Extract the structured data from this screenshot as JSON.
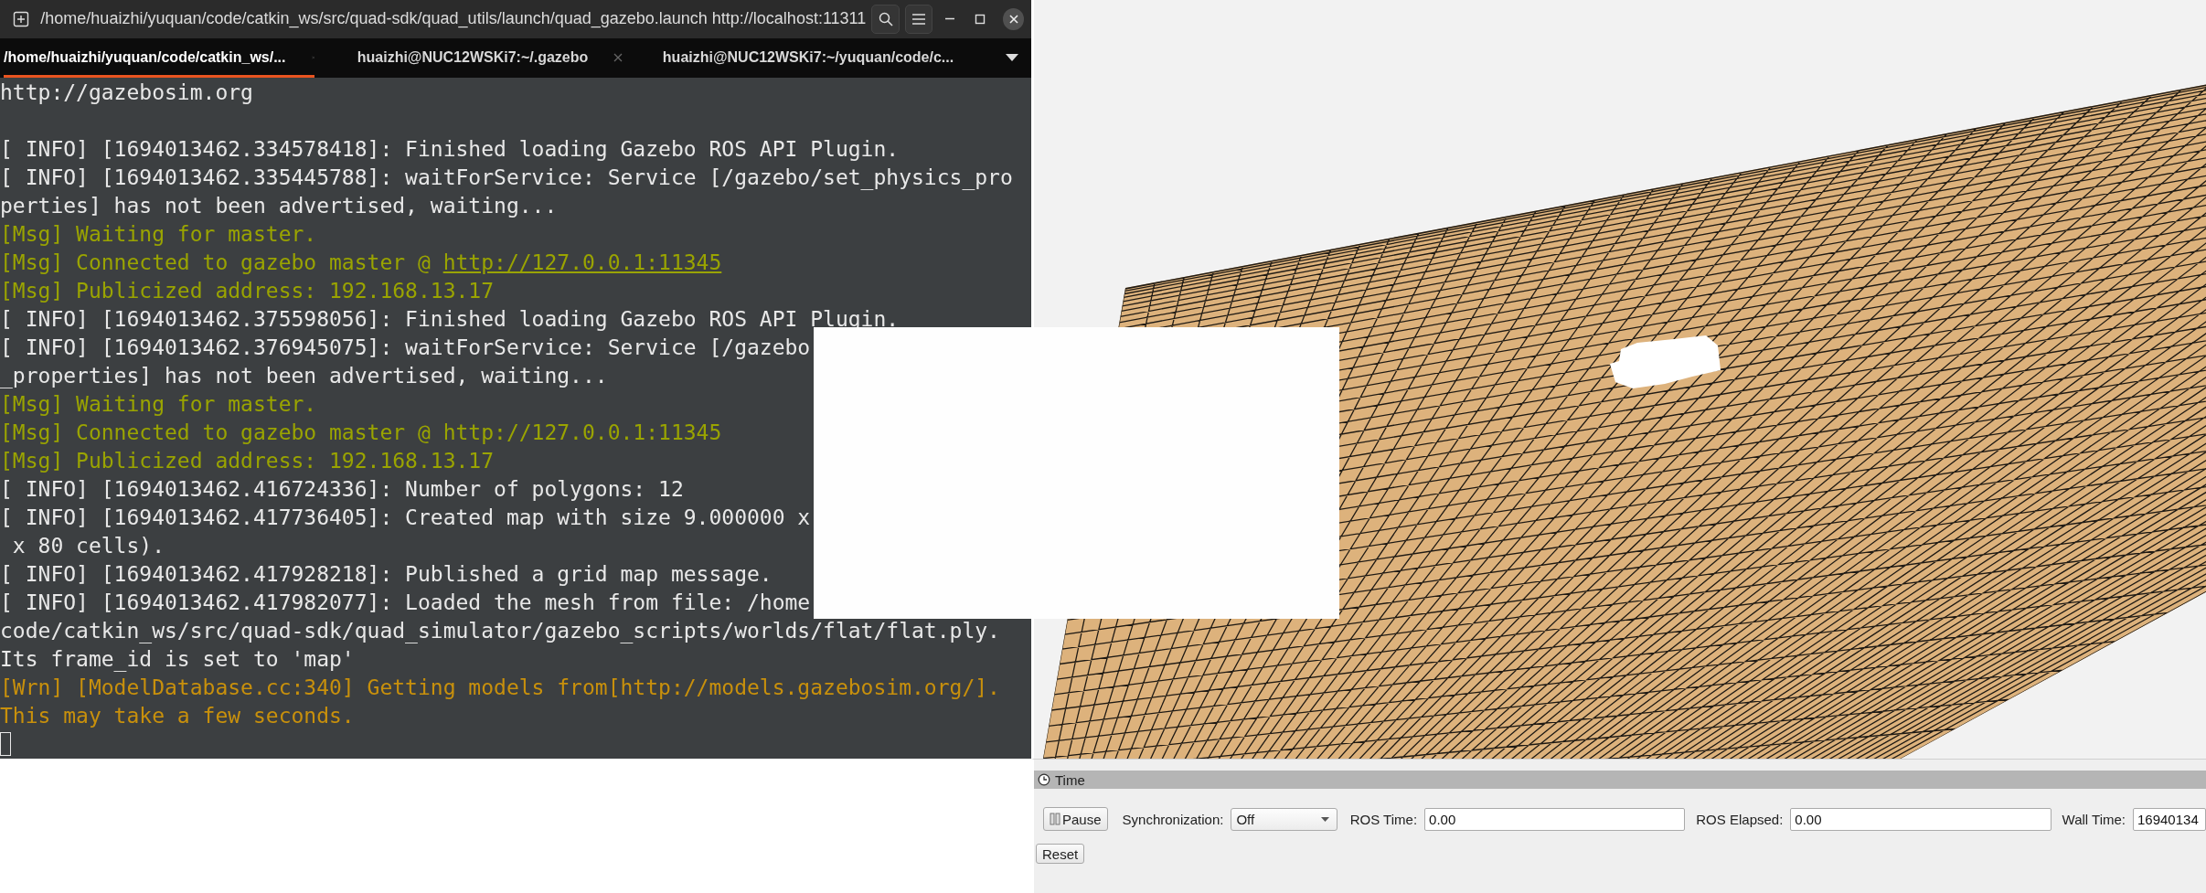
{
  "terminal": {
    "title": "/home/huaizhi/yuquan/code/catkin_ws/src/quad-sdk/quad_utils/launch/quad_gazebo.launch http://localhost:11311",
    "tabs": [
      {
        "label": "/home/huaizhi/yuquan/code/catkin_ws/...",
        "selected": true
      },
      {
        "label": "huaizhi@NUC12WSKi7:~/.gazebo",
        "selected": false
      },
      {
        "label": "huaizhi@NUC12WSKi7:~/yuquan/code/c...",
        "selected": false
      }
    ],
    "lines": [
      {
        "kind": "normal",
        "text": "http://gazebosim.org"
      },
      {
        "kind": "blank"
      },
      {
        "kind": "normal",
        "text": "[ INFO] [1694013462.334578418]: Finished loading Gazebo ROS API Plugin."
      },
      {
        "kind": "normal",
        "text": "[ INFO] [1694013462.335445788]: waitForService: Service [/gazebo/set_physics_pro"
      },
      {
        "kind": "normal",
        "text": "perties] has not been advertised, waiting..."
      },
      {
        "kind": "msg",
        "text": "[Msg] Waiting for master."
      },
      {
        "kind": "msg",
        "text": "[Msg] Connected to gazebo master @ ",
        "link": "http://127.0.0.1:11345"
      },
      {
        "kind": "msg",
        "text": "[Msg] Publicized address: 192.168.13.17"
      },
      {
        "kind": "normal",
        "text": "[ INFO] [1694013462.375598056]: Finished loading Gazebo ROS API Plugin."
      },
      {
        "kind": "normal",
        "text": "[ INFO] [1694013462.376945075]: waitForService: Service [/gazebo"
      },
      {
        "kind": "normal",
        "text": "_properties] has not been advertised, waiting..."
      },
      {
        "kind": "msg",
        "text": "[Msg] Waiting for master."
      },
      {
        "kind": "msg",
        "text": "[Msg] Connected to gazebo master @ http://127.0.0.1:11345"
      },
      {
        "kind": "msg",
        "text": "[Msg] Publicized address: 192.168.13.17"
      },
      {
        "kind": "normal",
        "text": "[ INFO] [1694013462.416724336]: Number of polygons: 12"
      },
      {
        "kind": "normal",
        "text": "[ INFO] [1694013462.417736405]: Created map with size 9.000000 x"
      },
      {
        "kind": "normal",
        "text": " x 80 cells)."
      },
      {
        "kind": "normal",
        "text": "[ INFO] [1694013462.417928218]: Published a grid map message."
      },
      {
        "kind": "normal",
        "text": "[ INFO] [1694013462.417982077]: Loaded the mesh from file: /home"
      },
      {
        "kind": "normal",
        "text": "code/catkin_ws/src/quad-sdk/quad_simulator/gazebo_scripts/worlds/flat/flat.ply."
      },
      {
        "kind": "normal",
        "text": "Its frame_id is set to 'map'"
      },
      {
        "kind": "warn",
        "text": "[Wrn] [ModelDatabase.cc:340] Getting models from[http://models.gazebosim.org/]."
      },
      {
        "kind": "warn",
        "text": "This may take a few seconds."
      }
    ],
    "cursor_visible": true
  },
  "time_panel": {
    "title": "Time",
    "pause_button": "Pause",
    "sync_label": "Synchronization:",
    "sync_value": "Off",
    "ros_time_label": "ROS Time:",
    "ros_time": "0.00",
    "ros_elapsed_label": "ROS Elapsed:",
    "ros_elapsed": "0.00",
    "wall_time_label": "Wall Time:",
    "wall_time": "16940134",
    "reset_button": "Reset"
  }
}
